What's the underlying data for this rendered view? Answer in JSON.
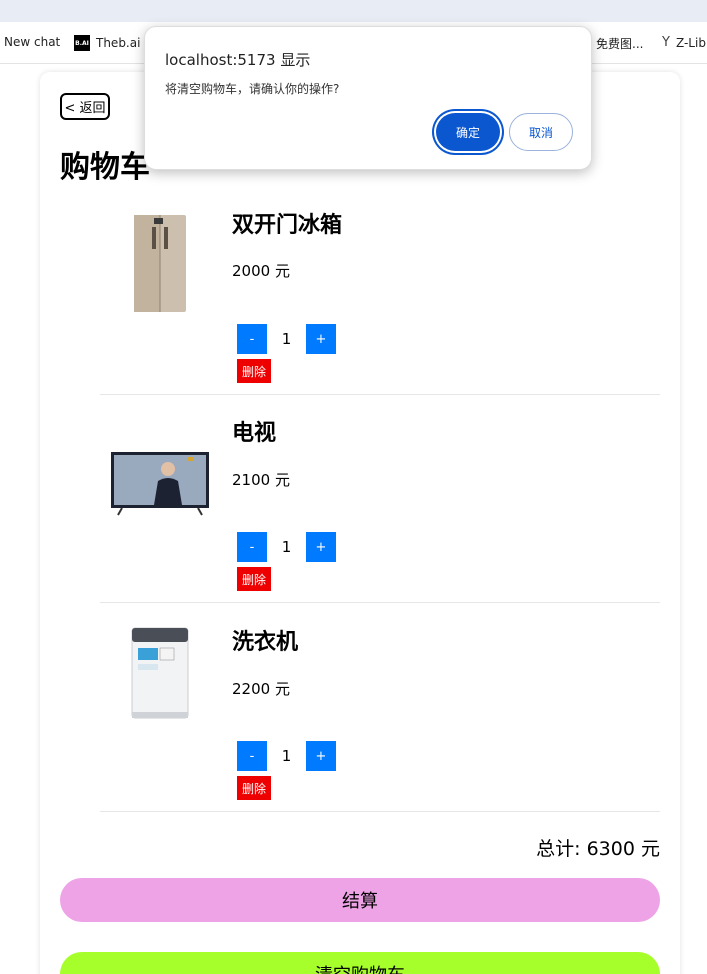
{
  "browser": {
    "bookmarks": [
      {
        "label": "New chat",
        "icon": "none"
      },
      {
        "label": "Theb.ai",
        "icon": "thebai-logo",
        "icon_text": "B.AI"
      },
      {
        "label": "免费图...",
        "icon": "none"
      },
      {
        "label": "Z-Lib",
        "icon": "z-library-logo",
        "icon_text": "Y"
      }
    ]
  },
  "dialog": {
    "title": "localhost:5173 显示",
    "message": "将清空购物车，请确认你的操作?",
    "confirm_label": "确定",
    "cancel_label": "取消"
  },
  "page": {
    "back_label": "< 返回",
    "title": "购物车"
  },
  "cart": {
    "items": [
      {
        "name": "双开门冰箱",
        "price": "2000 元",
        "qty": "1",
        "minus": "-",
        "plus": "+",
        "delete": "删除",
        "image": "fridge"
      },
      {
        "name": "电视",
        "price": "2100 元",
        "qty": "1",
        "minus": "-",
        "plus": "+",
        "delete": "删除",
        "image": "tv"
      },
      {
        "name": "洗衣机",
        "price": "2200 元",
        "qty": "1",
        "minus": "-",
        "plus": "+",
        "delete": "删除",
        "image": "washing-machine"
      }
    ],
    "total": "总计: 6300 元",
    "checkout_label": "结算",
    "clear_label": "清空购物车"
  },
  "colors": {
    "qty_button": "#007bff",
    "delete_button": "#ee0000",
    "checkout": "#eea3e6",
    "clear": "#a6ff2a",
    "dialog_accent": "#0b57d0"
  }
}
